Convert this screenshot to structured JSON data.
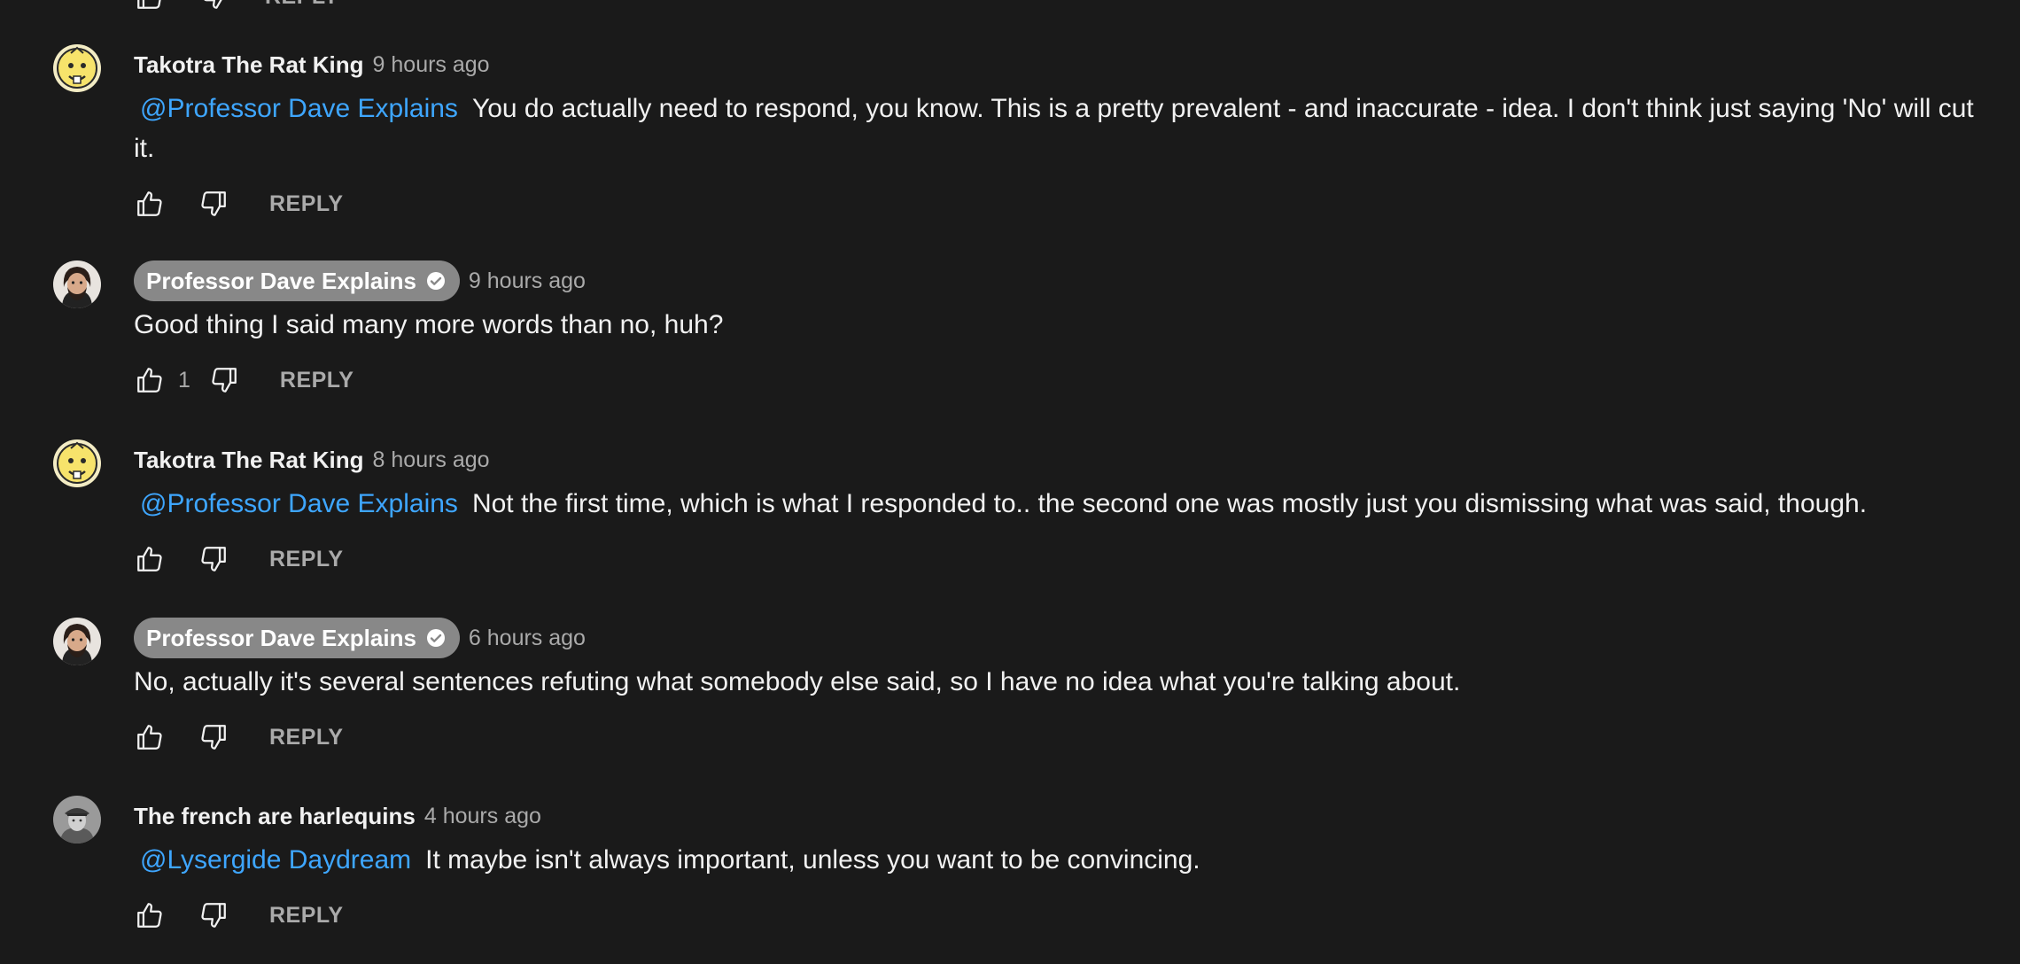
{
  "prev_comment": {
    "reply_label": "REPLY"
  },
  "comments": [
    {
      "author": "Takotra The Rat King",
      "timestamp": "9 hours ago",
      "mention": "@Professor Dave Explains",
      "text": "You do actually need to respond, you know. This is a pretty prevalent - and inaccurate - idea. I don't think just saying 'No' will cut it.",
      "reply_label": "REPLY"
    },
    {
      "author": "Professor Dave Explains",
      "timestamp": "9 hours ago",
      "text": "Good thing I said many more words than no, huh?",
      "like_count": "1",
      "reply_label": "REPLY"
    },
    {
      "author": "Takotra The Rat King",
      "timestamp": "8 hours ago",
      "mention": "@Professor Dave Explains",
      "text": "Not the first time, which is what I responded to.. the second one was mostly just you dismissing what was said, though.",
      "reply_label": "REPLY"
    },
    {
      "author": "Professor Dave Explains",
      "timestamp": "6 hours ago",
      "text": "No, actually it's several sentences refuting what somebody else said, so I have no idea what you're talking about.",
      "reply_label": "REPLY"
    },
    {
      "author": "The french are harlequins",
      "timestamp": "4 hours ago",
      "mention": "@Lysergide Daydream",
      "text": "It maybe isn't always important, unless you want to be convincing.",
      "reply_label": "REPLY"
    }
  ],
  "icons": {
    "like": "thumbs-up-icon",
    "dislike": "thumbs-down-icon",
    "verified": "verified-check-icon"
  },
  "colors": {
    "background": "#1a1a1a",
    "mention": "#3ea6ff",
    "author_chip": "#888888",
    "secondary_text": "#aaaaaa"
  }
}
